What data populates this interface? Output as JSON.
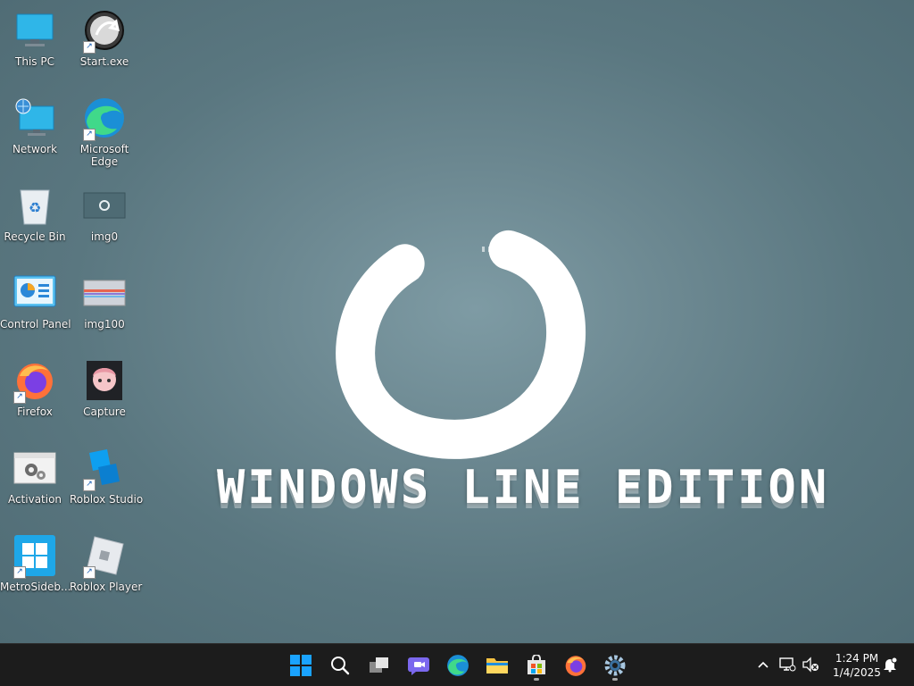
{
  "desktop": {
    "icons": [
      {
        "label": "This PC"
      },
      {
        "label": "Start.exe"
      },
      {
        "label": "Network"
      },
      {
        "label": "Microsoft Edge"
      },
      {
        "label": "Recycle Bin"
      },
      {
        "label": "img0"
      },
      {
        "label": "Control Panel"
      },
      {
        "label": "img100"
      },
      {
        "label": "Firefox"
      },
      {
        "label": "Capture"
      },
      {
        "label": "Activation"
      },
      {
        "label": "Roblox Studio"
      },
      {
        "label": "MetroSideb..."
      },
      {
        "label": "Roblox Player"
      }
    ],
    "wallpaper_title": "Windows Line Edition"
  },
  "taskbar": {
    "apps": [
      "start",
      "search",
      "task-view",
      "chat",
      "edge",
      "file-explorer",
      "microsoft-store",
      "firefox",
      "settings"
    ],
    "clock": {
      "time": "1:24 PM",
      "date": "1/4/2025"
    }
  },
  "colors": {
    "taskbar_bg": "#1c1c1c",
    "wallpaper_bg": "#5f7c85",
    "windows_blue": "#0078d4"
  }
}
